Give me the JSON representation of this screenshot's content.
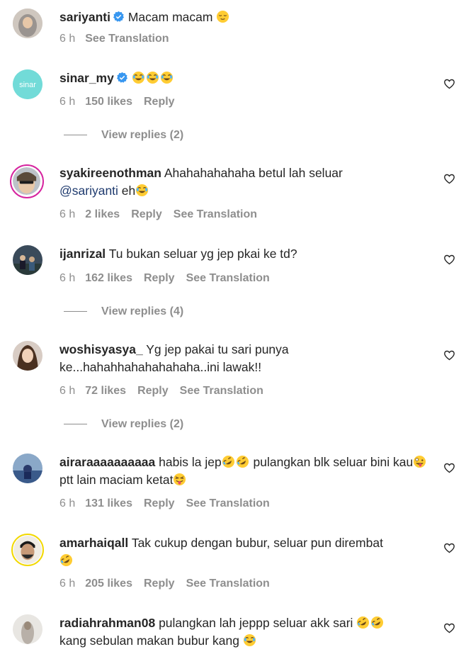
{
  "comments": [
    {
      "username": "sariyanti",
      "verified": true,
      "text_before": " Macam macam ",
      "emoji": [
        "relieved"
      ],
      "time": "6 h",
      "likes": "",
      "reply": "",
      "translate": "See Translation"
    },
    {
      "username": "sinar_my",
      "verified": true,
      "text_before": " ",
      "emoji": [
        "joy",
        "joy",
        "joy"
      ],
      "time": "6 h",
      "likes": "150 likes",
      "reply": "Reply",
      "translate": ""
    },
    {
      "username": "syakireenothman",
      "text": " Ahahahahahaha betul lah seluar",
      "mention": "@sariyanti",
      "text_after": " eh",
      "time": "6 h",
      "likes": "2 likes",
      "reply": "Reply",
      "translate": "See Translation"
    },
    {
      "username": "ijanrizal",
      "text": " Tu bukan seluar yg jep pkai ke td?",
      "time": "6 h",
      "likes": "162 likes",
      "reply": "Reply",
      "translate": "See Translation"
    },
    {
      "username": "woshisyasya_",
      "text": " Yg jep pakai tu sari punya ke...hahahhahahahahaha..ini lawak!!",
      "time": "6 h",
      "likes": "72 likes",
      "reply": "Reply",
      "translate": "See Translation"
    },
    {
      "username": "airaraaaaaaaaaa",
      "text_a": " habis la jep",
      "text_b": " pulangkan blk seluar bini kau",
      "text_c": "ptt lain maciam ketat",
      "time": "6 h",
      "likes": "131 likes",
      "reply": "Reply",
      "translate": "See Translation"
    },
    {
      "username": "amarhaiqall",
      "text": " Tak cukup dengan bubur, seluar pun diremba",
      "text_end": "t",
      "time": "6 h",
      "likes": "205 likes",
      "reply": "Reply",
      "translate": "See Translation"
    },
    {
      "username": "radiahrahman08",
      "text_a": " pulangkan lah jeppp seluar akk sari ",
      "text_b": " kang sebulan makan bubur kang ",
      "time": "",
      "likes": "",
      "reply": "",
      "translate": ""
    }
  ],
  "view_replies": [
    "View replies (2)",
    "View replies (4)",
    "View replies (2)"
  ],
  "avatars": {
    "sinar_logo": "sinar"
  },
  "colors": {
    "verified": "#3897f0",
    "muted": "#8e8e8e",
    "text": "#262626",
    "mention": "#1e3a6e"
  }
}
